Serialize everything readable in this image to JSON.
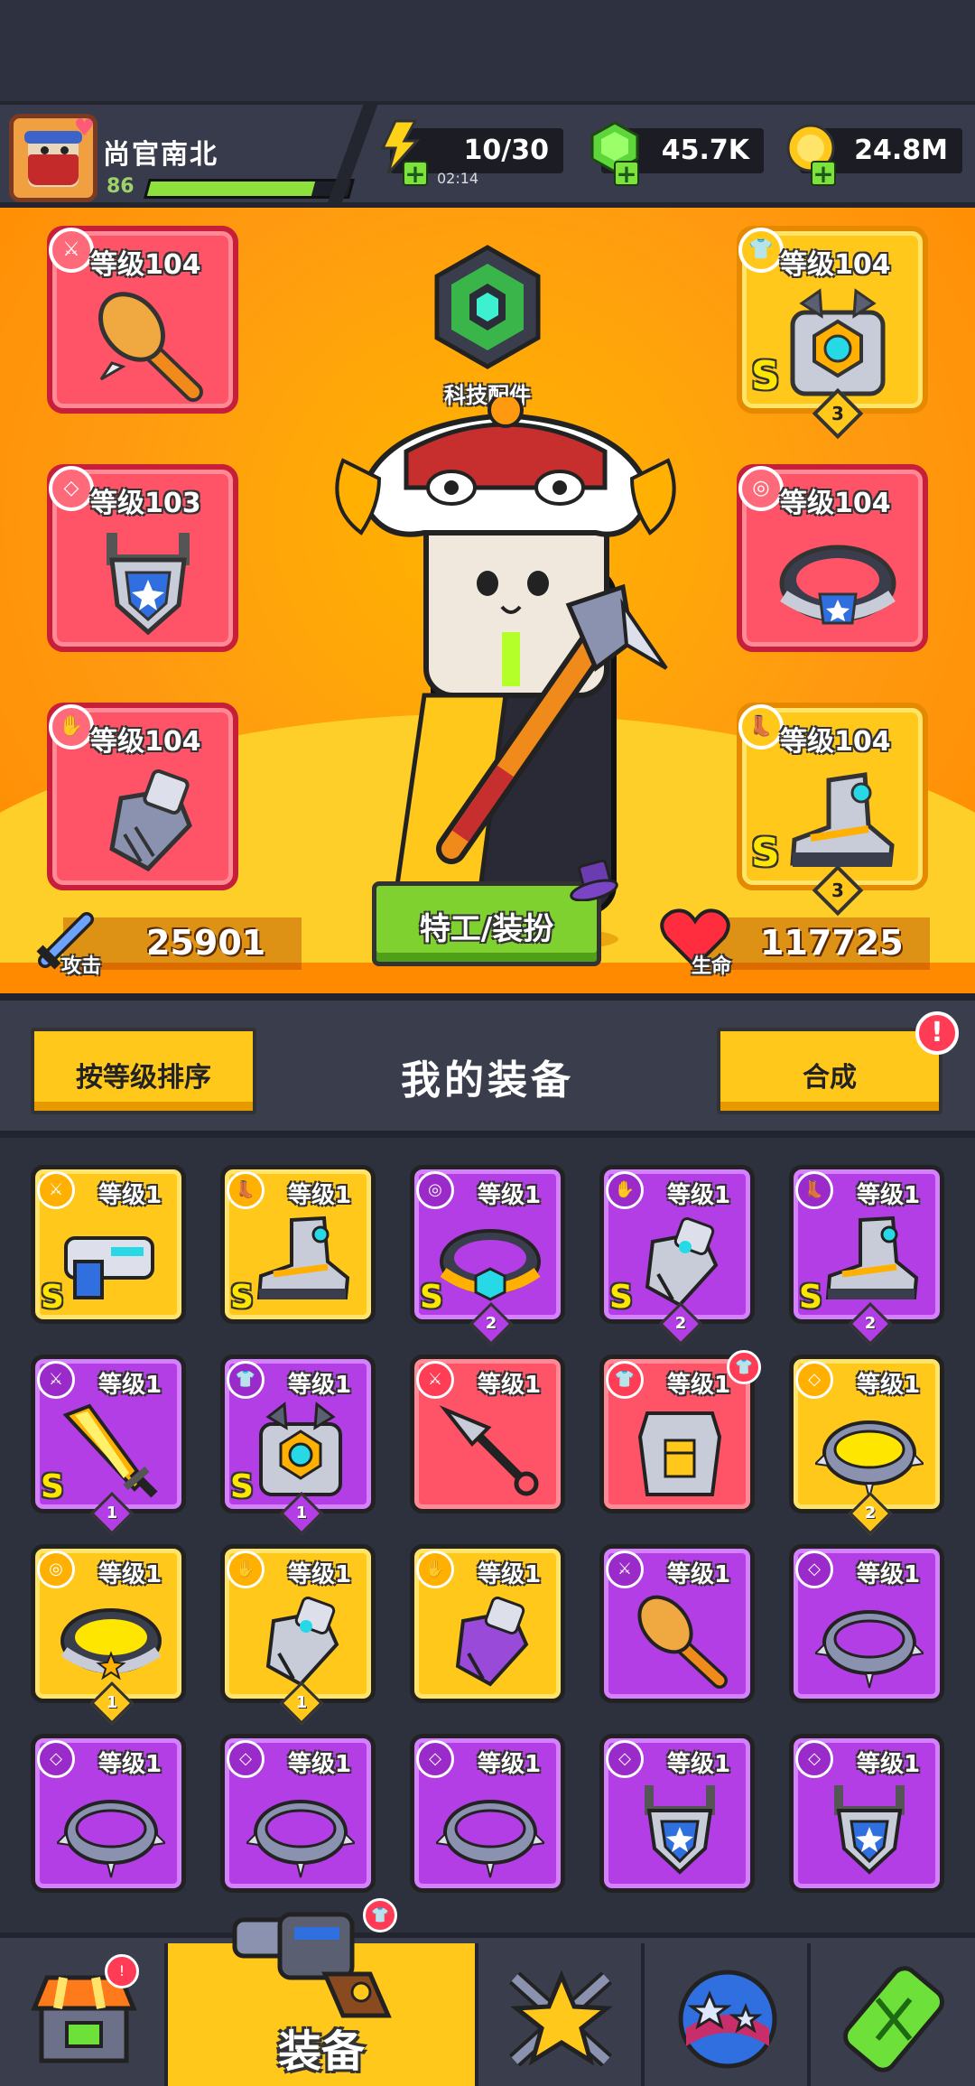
{
  "player": {
    "name": "尚官南北",
    "level": "86",
    "xp_fraction": 0.82
  },
  "resources": {
    "energy": {
      "value": "10/30",
      "timer": "02:14",
      "icon": "lightning-icon"
    },
    "gems": {
      "value": "45.7K",
      "icon": "green-gem-icon"
    },
    "coins": {
      "value": "24.8M",
      "icon": "gold-coin-icon"
    }
  },
  "tech_part": {
    "label": "科技配件"
  },
  "equipped": {
    "weapon": {
      "level": "等级104",
      "item": "mace",
      "rarity": "red"
    },
    "armor": {
      "level": "等级104",
      "item": "robot-chest",
      "rarity": "gold",
      "grade": "S",
      "stars": "3"
    },
    "necklace": {
      "level": "等级103",
      "item": "shield-amulet",
      "rarity": "red"
    },
    "belt": {
      "level": "等级104",
      "item": "blue-belt",
      "rarity": "red"
    },
    "gloves": {
      "level": "等级104",
      "item": "gauntlet",
      "rarity": "red"
    },
    "boots": {
      "level": "等级104",
      "item": "mech-boots",
      "rarity": "gold",
      "grade": "S",
      "stars": "3"
    }
  },
  "agent_button": "特工/装扮",
  "stats": {
    "attack_value": "25901",
    "attack_label": "攻击",
    "hp_value": "117725",
    "hp_label": "生命"
  },
  "equipment_header": {
    "sort_button": "按等级排序",
    "title": "我的装备",
    "merge_button": "合成",
    "alert": "!"
  },
  "inventory": [
    {
      "rarity": "gold",
      "level": "等级1",
      "grade": "S",
      "stars": "",
      "slot": "weapon",
      "item": "blaster"
    },
    {
      "rarity": "gold",
      "level": "等级1",
      "grade": "S",
      "stars": "",
      "slot": "boots",
      "item": "mech-boots"
    },
    {
      "rarity": "purple",
      "level": "等级1",
      "grade": "S",
      "stars": "2",
      "slot": "belt",
      "item": "hex-belt"
    },
    {
      "rarity": "purple",
      "level": "等级1",
      "grade": "S",
      "stars": "2",
      "slot": "gloves",
      "item": "gauntlet"
    },
    {
      "rarity": "purple",
      "level": "等级1",
      "grade": "S",
      "stars": "2",
      "slot": "boots",
      "item": "mech-boots"
    },
    {
      "rarity": "purple",
      "level": "等级1",
      "grade": "S",
      "stars": "1",
      "slot": "weapon",
      "item": "flame-sword"
    },
    {
      "rarity": "purple",
      "level": "等级1",
      "grade": "S",
      "stars": "1",
      "slot": "armor",
      "item": "robot-chest"
    },
    {
      "rarity": "red",
      "level": "等级1",
      "grade": "",
      "stars": "",
      "slot": "weapon",
      "item": "kunai"
    },
    {
      "rarity": "red",
      "level": "等级1",
      "grade": "",
      "stars": "",
      "slot": "armor",
      "item": "chest-plate",
      "new": true
    },
    {
      "rarity": "gold",
      "level": "等级1",
      "grade": "",
      "stars": "2",
      "slot": "necklace",
      "item": "spike-ring"
    },
    {
      "rarity": "gold",
      "level": "等级1",
      "grade": "",
      "stars": "1",
      "slot": "belt",
      "item": "star-belt"
    },
    {
      "rarity": "gold",
      "level": "等级1",
      "grade": "",
      "stars": "1",
      "slot": "gloves",
      "item": "gauntlet"
    },
    {
      "rarity": "gold",
      "level": "等级1",
      "grade": "",
      "stars": "",
      "slot": "gloves",
      "item": "purple-gauntlet"
    },
    {
      "rarity": "purple",
      "level": "等级1",
      "grade": "",
      "stars": "",
      "slot": "weapon",
      "item": "mace"
    },
    {
      "rarity": "purple",
      "level": "等级1",
      "grade": "",
      "stars": "",
      "slot": "necklace",
      "item": "spike-ring"
    },
    {
      "rarity": "purple",
      "level": "等级1",
      "grade": "",
      "stars": "",
      "slot": "necklace",
      "item": "spike-ring"
    },
    {
      "rarity": "purple",
      "level": "等级1",
      "grade": "",
      "stars": "",
      "slot": "necklace",
      "item": "spike-ring"
    },
    {
      "rarity": "purple",
      "level": "等级1",
      "grade": "",
      "stars": "",
      "slot": "necklace",
      "item": "spike-ring"
    },
    {
      "rarity": "purple",
      "level": "等级1",
      "grade": "",
      "stars": "",
      "slot": "necklace",
      "item": "shield-amulet"
    },
    {
      "rarity": "purple",
      "level": "等级1",
      "grade": "",
      "stars": "",
      "slot": "necklace",
      "item": "shield-amulet"
    }
  ],
  "nav": [
    {
      "name": "shop",
      "label": "",
      "icon": "shop-icon",
      "alert": "!"
    },
    {
      "name": "equipment",
      "label": "装备",
      "icon": "revolver-icon",
      "active": true
    },
    {
      "name": "heroes",
      "label": "",
      "icon": "star-swords-icon"
    },
    {
      "name": "planet",
      "label": "",
      "icon": "planet-icon"
    },
    {
      "name": "evolve",
      "label": "",
      "icon": "dna-capsule-icon"
    }
  ],
  "colors": {
    "gold": "#ffc81a",
    "purple": "#b43ee6",
    "red": "#ff5468",
    "background": "#2d303d",
    "hero_bg": "#ff9a10"
  }
}
